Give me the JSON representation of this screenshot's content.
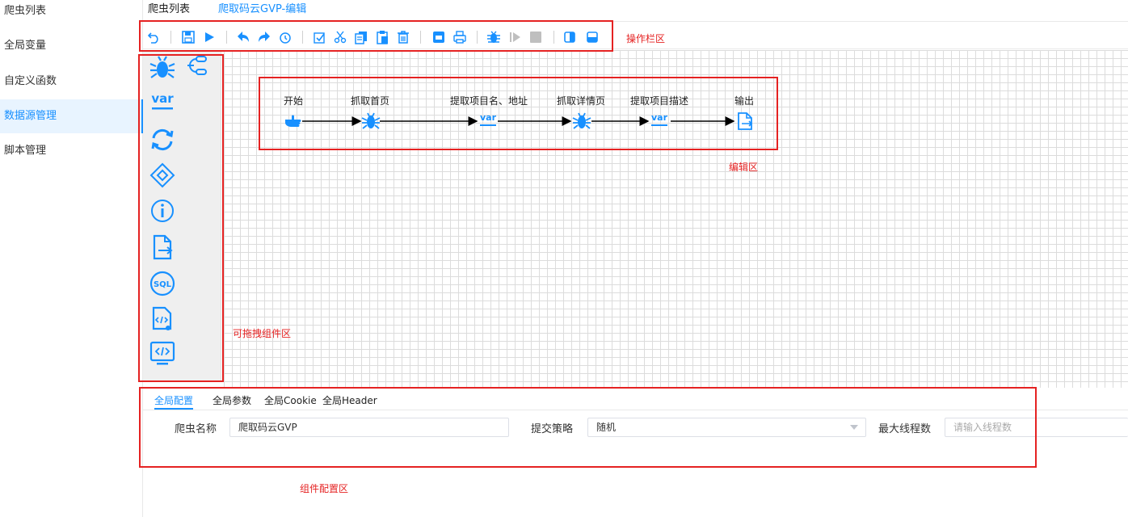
{
  "sidebar": {
    "items": [
      {
        "label": "爬虫列表"
      },
      {
        "label": "全局变量"
      },
      {
        "label": "自定义函数"
      },
      {
        "label": "数据源管理"
      },
      {
        "label": "脚本管理"
      }
    ]
  },
  "tabs": {
    "list_label": "爬虫列表",
    "edit_label": "爬取码云GVP-编辑"
  },
  "toolbar": {
    "buttons": [
      "undo-icon",
      "save-icon",
      "run-icon",
      "undo-arrow-icon",
      "redo-arrow-icon",
      "history-icon",
      "select-all-icon",
      "cut-icon",
      "copy-icon",
      "paste-icon",
      "delete-icon",
      "export-image-icon",
      "print-icon",
      "debug-icon",
      "step-icon",
      "stop-icon",
      "panel-right-icon",
      "panel-bottom-icon"
    ]
  },
  "palette": {
    "icons": [
      "spider-icon",
      "loop-link-icon",
      "variable-icon",
      "refresh-loop-icon",
      "diamond-condition-icon",
      "info-icon",
      "output-file-icon",
      "sql-icon",
      "script-file-icon",
      "code-monitor-icon"
    ]
  },
  "flow": {
    "nodes": [
      {
        "label": "开始",
        "icon": "start-hand-icon"
      },
      {
        "label": "抓取首页",
        "icon": "spider-icon"
      },
      {
        "label": "提取项目名、地址",
        "icon": "variable-icon"
      },
      {
        "label": "抓取详情页",
        "icon": "spider-icon"
      },
      {
        "label": "提取项目描述",
        "icon": "variable-icon"
      },
      {
        "label": "输出",
        "icon": "output-file-icon"
      }
    ],
    "var_text": "var"
  },
  "annotations": {
    "toolbar": "操作栏区",
    "editor": "编辑区",
    "palette": "可拖拽组件区",
    "config": "组件配置区"
  },
  "config": {
    "tabs": [
      "全局配置",
      "全局参数",
      "全局Cookie",
      "全局Header"
    ],
    "name_label": "爬虫名称",
    "name_value": "爬取码云GVP",
    "strategy_label": "提交策略",
    "strategy_value": "随机",
    "threads_label": "最大线程数",
    "threads_placeholder": "请输入线程数"
  },
  "colors": {
    "accent": "#1890ff",
    "annotation": "#e52222"
  }
}
